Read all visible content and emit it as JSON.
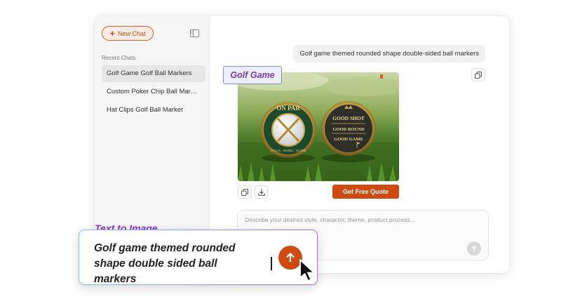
{
  "sidebar": {
    "new_chat_label": "New Chat",
    "recent_label": "Recent Chats",
    "chats": [
      {
        "label": "Golf Game Golf Ball Markers",
        "active": true
      },
      {
        "label": "Custom Poker Chip Ball Markers",
        "active": false
      },
      {
        "label": "Hat Clips Golf Ball Marker",
        "active": false
      }
    ]
  },
  "conversation": {
    "user_message": "Golf game themed rounded shape double-sided ball markers",
    "quote_button_label": "Get Free Quote",
    "image": {
      "coin_left": {
        "top_text": "ON PAR",
        "bottom_text": "FOCUS · SWING · SCORE"
      },
      "coin_right": {
        "line1": "GOOD SHOT",
        "line2": "GOOD ROUND",
        "line3": "GOOD GAME"
      }
    }
  },
  "composer": {
    "placeholder": "Describe your desired style, character, theme, product process..."
  },
  "overlay": {
    "tag_label": "Golf Game",
    "tti_label": "Text to Image",
    "tti_line1": "Golf game themed rounded",
    "tti_line2": "shape double sided ball markers"
  },
  "colors": {
    "accent": "#cf4a10",
    "tag_text": "#7f37bf",
    "sidebar_bg": "#f5f5f5"
  },
  "icons": {
    "new_chat": "plus-icon",
    "sidebar_toggle": "sidebar-toggle-icon",
    "copy": "copy-icon",
    "download": "download-icon",
    "send": "arrow-up-icon",
    "pointer": "cursor-arrow-icon"
  }
}
